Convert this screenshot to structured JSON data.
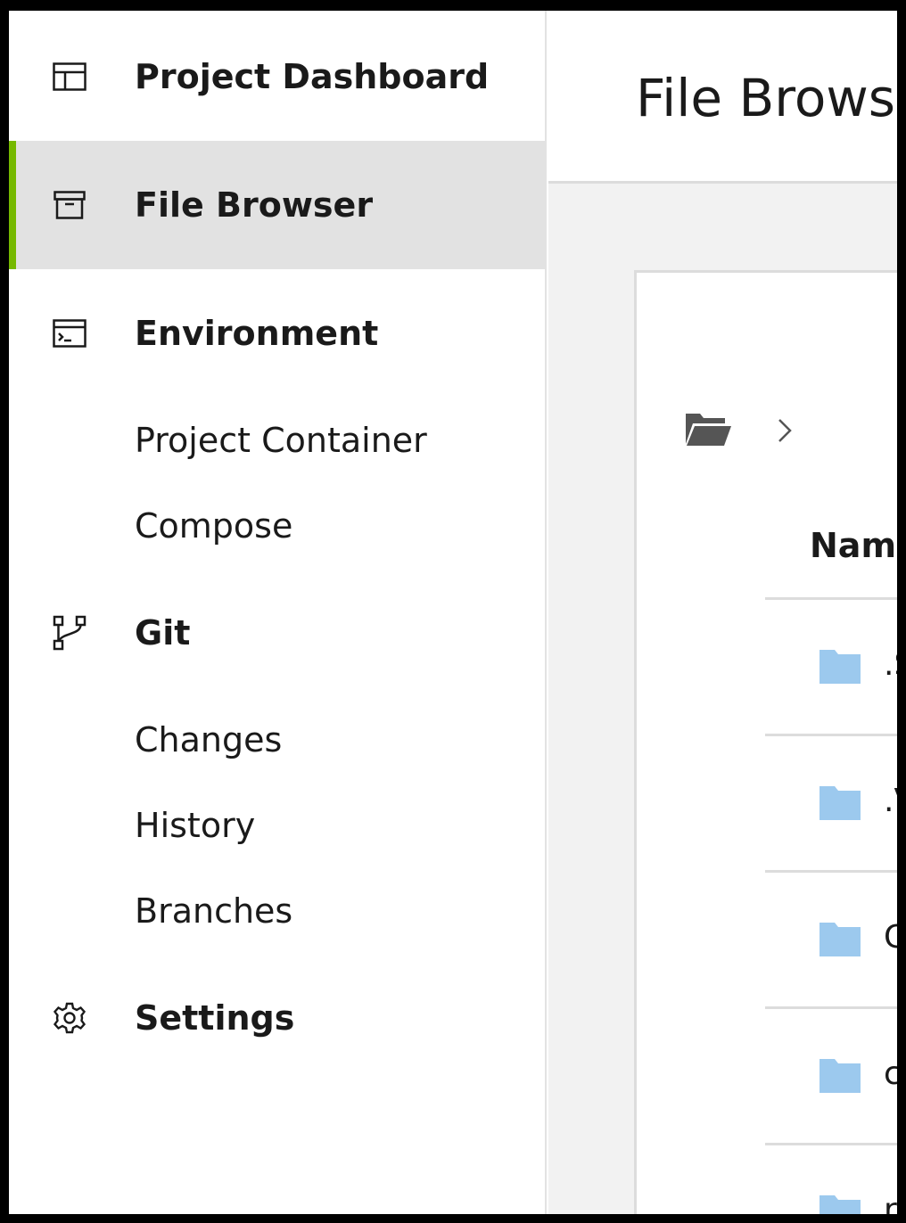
{
  "sidebar": {
    "items": [
      {
        "label": "Project Dashboard",
        "icon": "dashboard-icon"
      },
      {
        "label": "File Browser",
        "icon": "archive-icon",
        "active": true
      },
      {
        "label": "Environment",
        "icon": "terminal-window-icon",
        "subitems": [
          {
            "label": "Project Container"
          },
          {
            "label": "Compose"
          }
        ]
      },
      {
        "label": "Git",
        "icon": "git-branch-icon",
        "subitems": [
          {
            "label": "Changes"
          },
          {
            "label": "History"
          },
          {
            "label": "Branches"
          }
        ]
      },
      {
        "label": "Settings",
        "icon": "gear-icon"
      }
    ]
  },
  "main": {
    "title": "File Brows",
    "breadcrumb": {
      "icon": "folder-open-icon",
      "separator_icon": "chevron-right-icon"
    },
    "table": {
      "column_name": "Nam",
      "rows": [
        {
          "name": ".S",
          "icon": "folder-icon"
        },
        {
          "name": ".V",
          "icon": "folder-icon"
        },
        {
          "name": "C",
          "icon": "folder-icon"
        },
        {
          "name": "c",
          "icon": "folder-icon"
        },
        {
          "name": "r",
          "icon": "folder-icon"
        }
      ]
    }
  },
  "colors": {
    "accent": "#76b900",
    "active_bg": "#e2e2e2",
    "folder": "#9cc9ee",
    "main_bg": "#f2f2f2"
  }
}
